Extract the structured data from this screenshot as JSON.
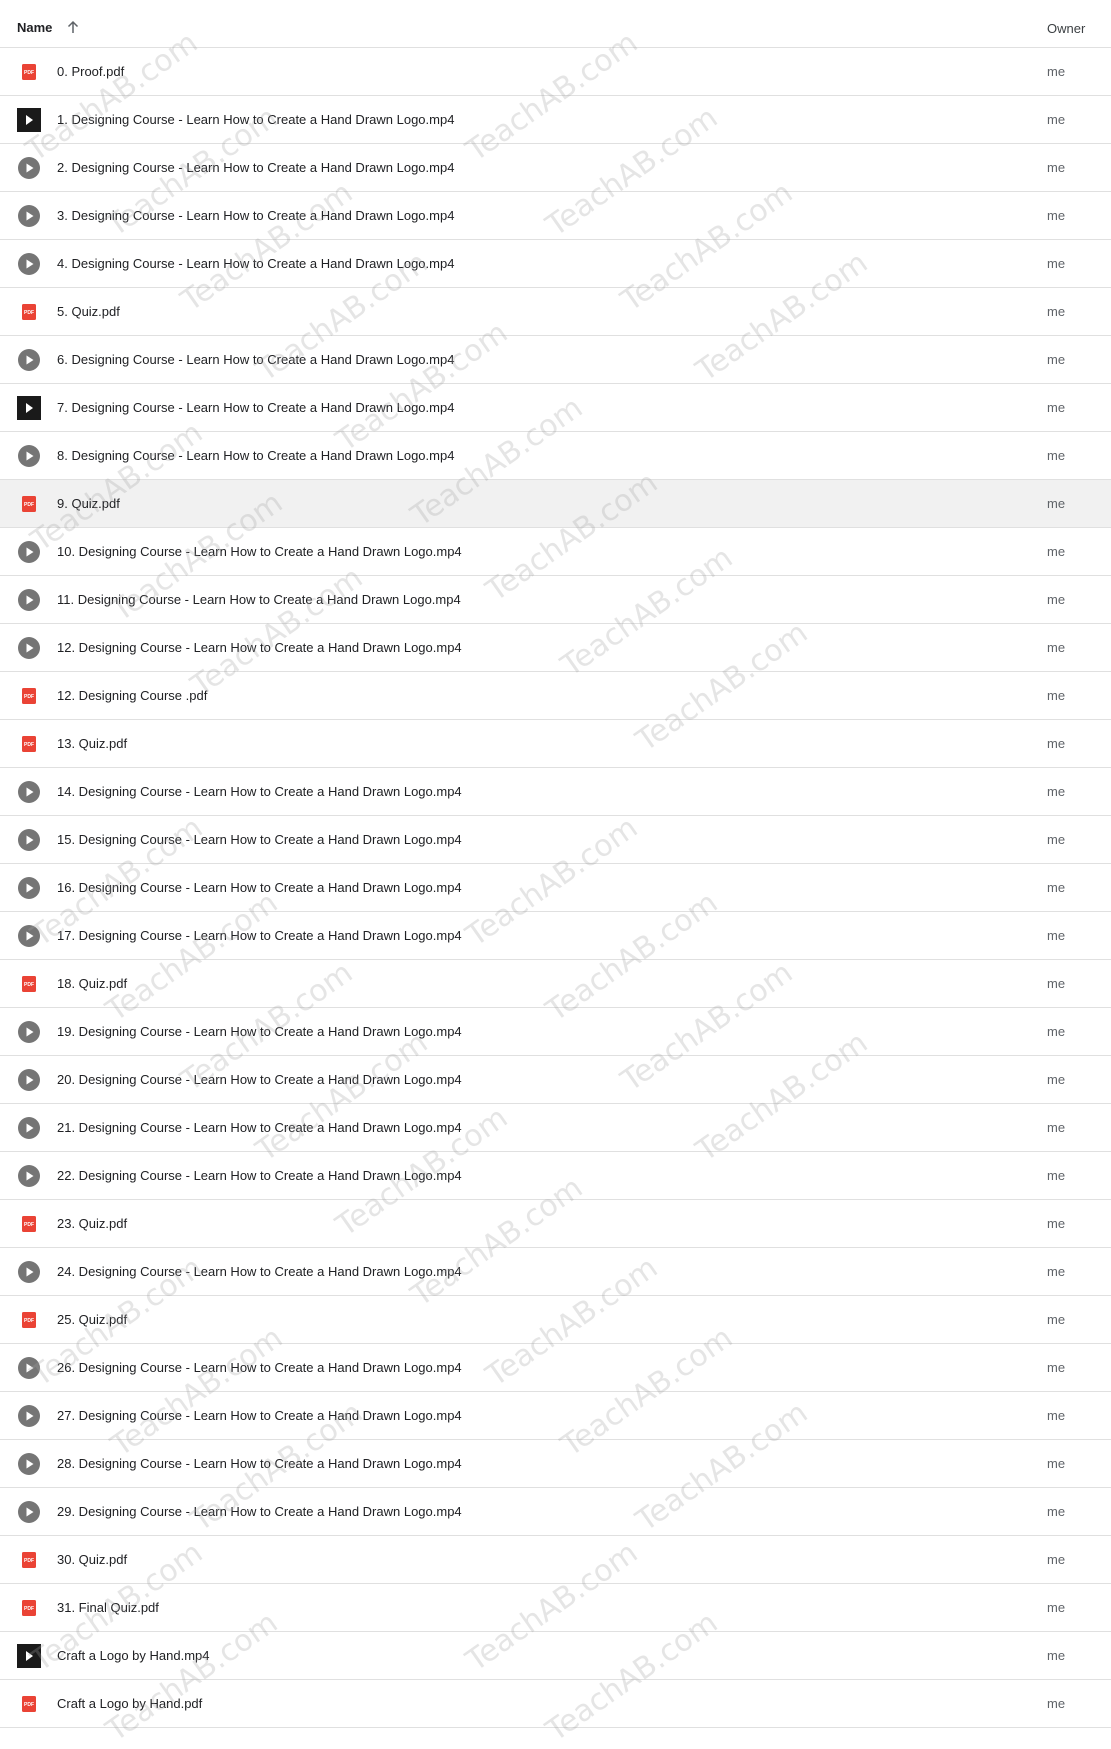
{
  "header": {
    "name_label": "Name",
    "owner_label": "Owner"
  },
  "watermark": "TeachAB.com",
  "selected_index": 9,
  "files": [
    {
      "name": "0. Proof.pdf",
      "type": "pdf",
      "owner": "me"
    },
    {
      "name": "1. Designing Course - Learn How to Create a Hand Drawn Logo.mp4",
      "type": "video-thumb",
      "owner": "me"
    },
    {
      "name": "2. Designing Course - Learn How to Create a Hand Drawn Logo.mp4",
      "type": "video",
      "owner": "me"
    },
    {
      "name": "3. Designing Course - Learn How to Create a Hand Drawn Logo.mp4",
      "type": "video",
      "owner": "me"
    },
    {
      "name": "4. Designing Course - Learn How to Create a Hand Drawn Logo.mp4",
      "type": "video",
      "owner": "me"
    },
    {
      "name": "5. Quiz.pdf",
      "type": "pdf",
      "owner": "me"
    },
    {
      "name": "6. Designing Course - Learn How to Create a Hand Drawn Logo.mp4",
      "type": "video",
      "owner": "me"
    },
    {
      "name": "7. Designing Course - Learn How to Create a Hand Drawn Logo.mp4",
      "type": "video-thumb",
      "owner": "me"
    },
    {
      "name": "8. Designing Course - Learn How to Create a Hand Drawn Logo.mp4",
      "type": "video",
      "owner": "me"
    },
    {
      "name": "9. Quiz.pdf",
      "type": "pdf",
      "owner": "me"
    },
    {
      "name": "10. Designing Course - Learn How to Create a Hand Drawn Logo.mp4",
      "type": "video",
      "owner": "me"
    },
    {
      "name": "11. Designing Course - Learn How to Create a Hand Drawn Logo.mp4",
      "type": "video",
      "owner": "me"
    },
    {
      "name": "12. Designing Course - Learn How to Create a Hand Drawn Logo.mp4",
      "type": "video",
      "owner": "me"
    },
    {
      "name": "12. Designing Course .pdf",
      "type": "pdf",
      "owner": "me"
    },
    {
      "name": "13. Quiz.pdf",
      "type": "pdf",
      "owner": "me"
    },
    {
      "name": "14. Designing Course - Learn How to Create a Hand Drawn Logo.mp4",
      "type": "video",
      "owner": "me"
    },
    {
      "name": "15. Designing Course - Learn How to Create a Hand Drawn Logo.mp4",
      "type": "video",
      "owner": "me"
    },
    {
      "name": "16. Designing Course - Learn How to Create a Hand Drawn Logo.mp4",
      "type": "video",
      "owner": "me"
    },
    {
      "name": "17. Designing Course - Learn How to Create a Hand Drawn Logo.mp4",
      "type": "video",
      "owner": "me"
    },
    {
      "name": "18. Quiz.pdf",
      "type": "pdf",
      "owner": "me"
    },
    {
      "name": "19. Designing Course - Learn How to Create a Hand Drawn Logo.mp4",
      "type": "video",
      "owner": "me"
    },
    {
      "name": "20. Designing Course - Learn How to Create a Hand Drawn Logo.mp4",
      "type": "video",
      "owner": "me"
    },
    {
      "name": "21. Designing Course - Learn How to Create a Hand Drawn Logo.mp4",
      "type": "video",
      "owner": "me"
    },
    {
      "name": "22. Designing Course - Learn How to Create a Hand Drawn Logo.mp4",
      "type": "video",
      "owner": "me"
    },
    {
      "name": "23. Quiz.pdf",
      "type": "pdf",
      "owner": "me"
    },
    {
      "name": "24. Designing Course - Learn How to Create a Hand Drawn Logo.mp4",
      "type": "video",
      "owner": "me"
    },
    {
      "name": "25. Quiz.pdf",
      "type": "pdf",
      "owner": "me"
    },
    {
      "name": "26. Designing Course - Learn How to Create a Hand Drawn Logo.mp4",
      "type": "video",
      "owner": "me"
    },
    {
      "name": "27. Designing Course - Learn How to Create a Hand Drawn Logo.mp4",
      "type": "video",
      "owner": "me"
    },
    {
      "name": "28. Designing Course - Learn How to Create a Hand Drawn Logo.mp4",
      "type": "video",
      "owner": "me"
    },
    {
      "name": "29. Designing Course - Learn How to Create a Hand Drawn Logo.mp4",
      "type": "video",
      "owner": "me"
    },
    {
      "name": "30. Quiz.pdf",
      "type": "pdf",
      "owner": "me"
    },
    {
      "name": "31. Final Quiz.pdf",
      "type": "pdf",
      "owner": "me"
    },
    {
      "name": "Craft a Logo by Hand.mp4",
      "type": "video-thumb",
      "owner": "me"
    },
    {
      "name": "Craft a Logo by Hand.pdf",
      "type": "pdf",
      "owner": "me"
    }
  ],
  "colors": {
    "pdf_red": "#ea4335",
    "video_gray": "#757575",
    "thumb_dark": "#1a1a1a",
    "selected_bg": "#f1f1f1"
  }
}
